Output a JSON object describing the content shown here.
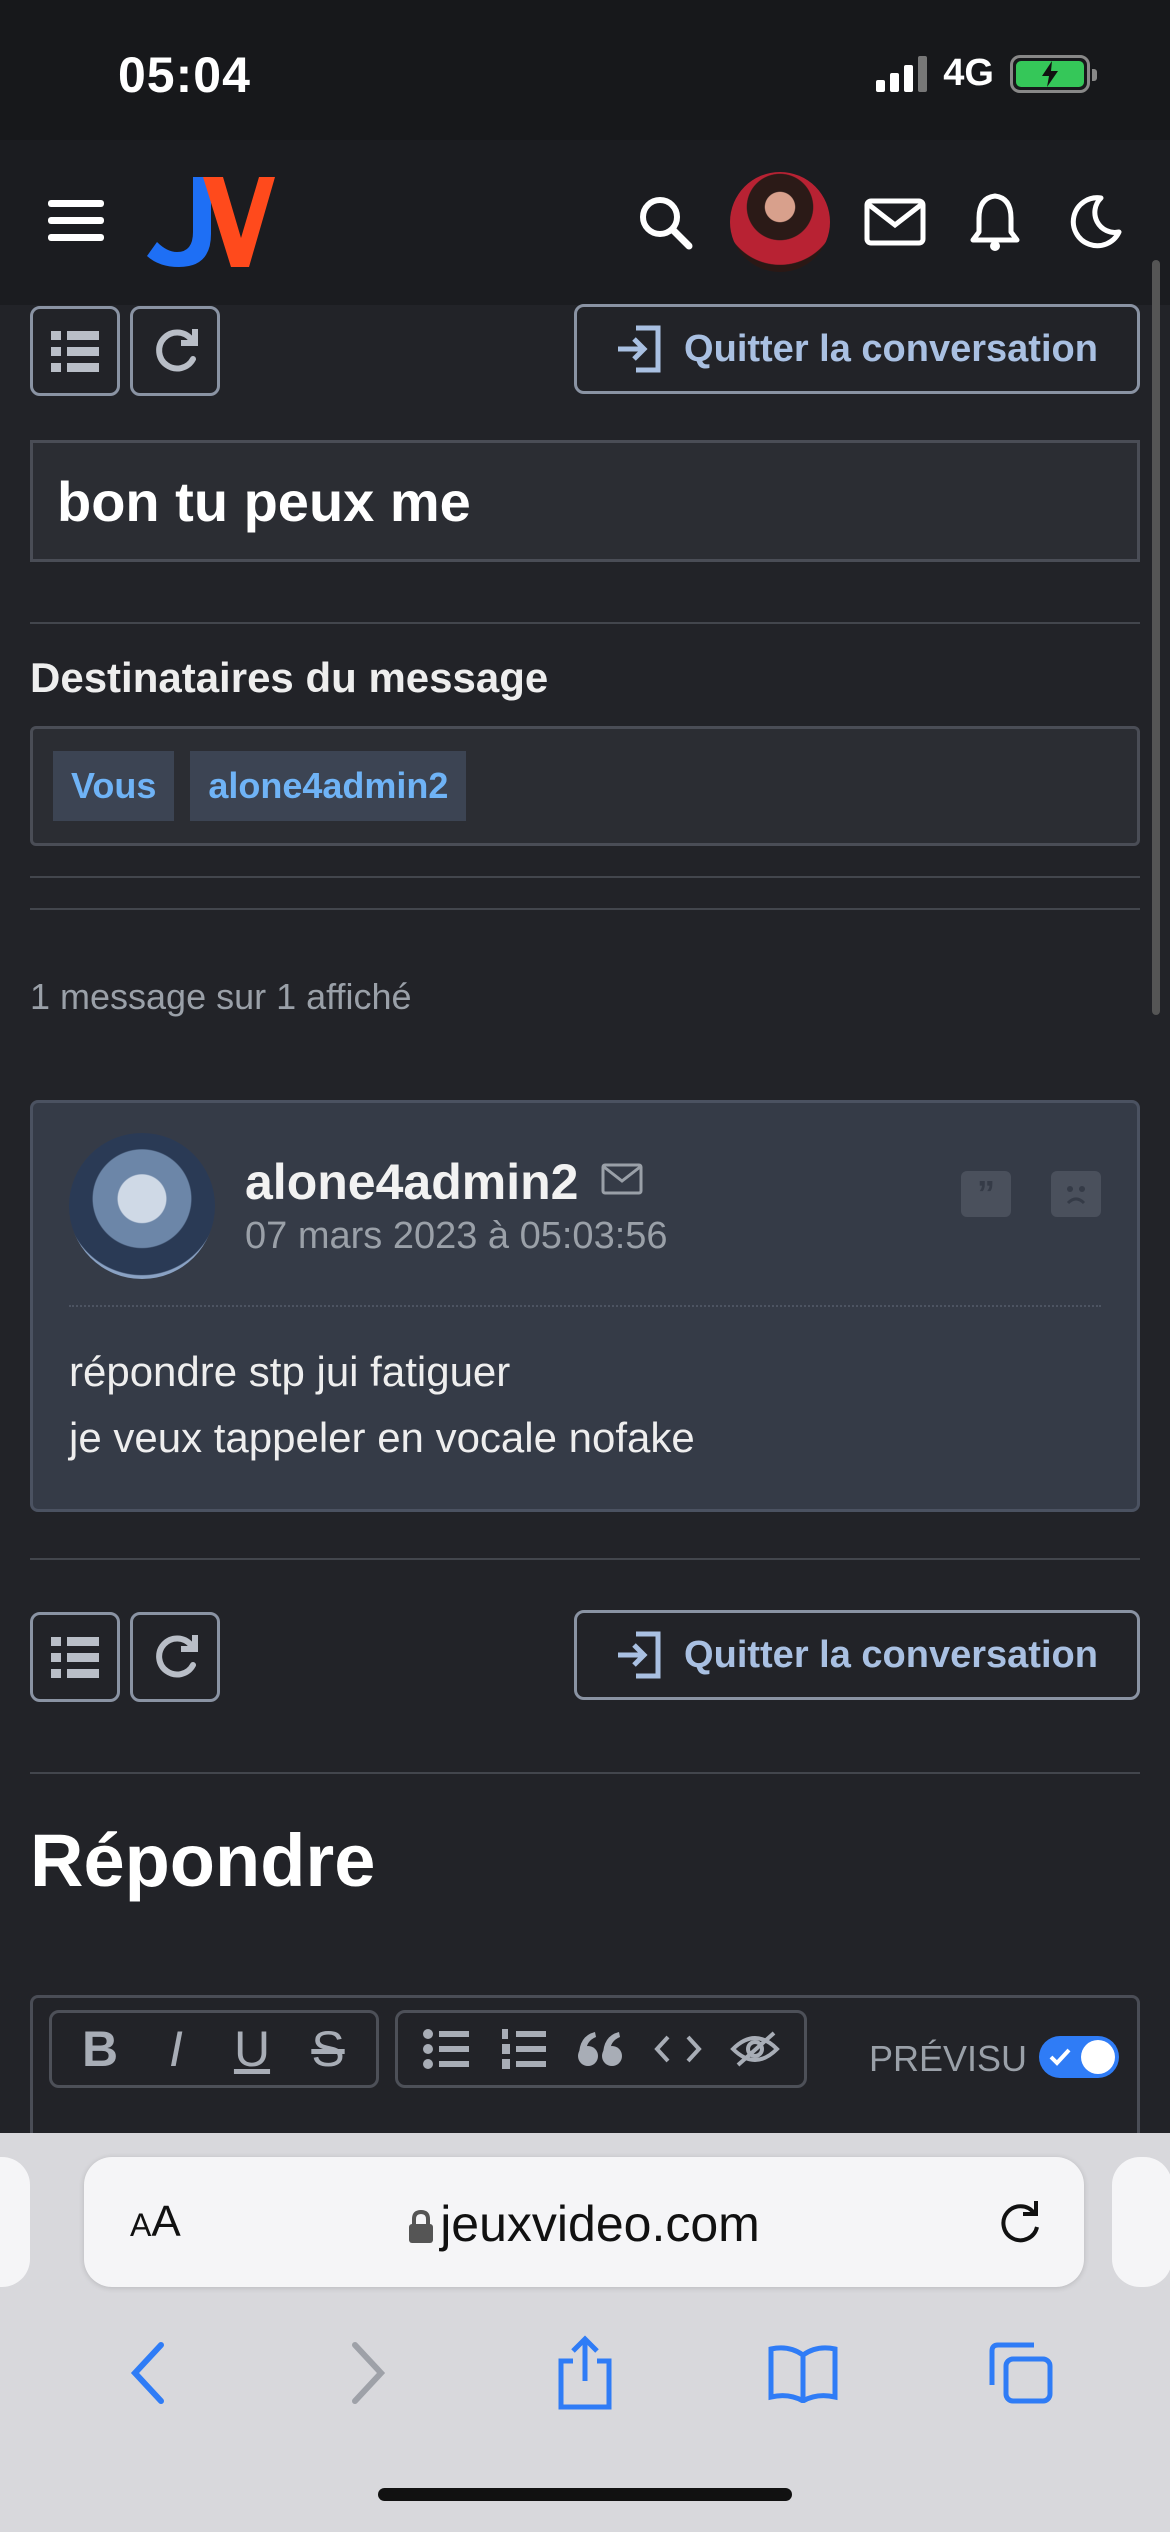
{
  "status_bar": {
    "time": "05:04",
    "network": "4G"
  },
  "nav": {
    "logo": "JV",
    "icons": [
      "menu-icon",
      "search-icon",
      "avatar",
      "mail-icon",
      "bell-icon",
      "moon-icon"
    ]
  },
  "conversation": {
    "quit_label": "Quitter la conversation",
    "title": "bon tu peux me",
    "recipients_title": "Destinataires du message",
    "recipients": [
      "Vous",
      "alone4admin2"
    ],
    "count": "1 message sur 1 affiché"
  },
  "message": {
    "author": "alone4admin2",
    "date": "07 mars 2023 à 05:03:56",
    "quote_icon": "”",
    "lines": [
      "répondre stp jui fatiguer",
      "je veux tappeler en vocale nofake"
    ]
  },
  "reply": {
    "title": "Répondre",
    "preview_label": "PRÉVISU",
    "preview_enabled": true,
    "toolbar": {
      "bold": "B",
      "italic": "I",
      "underline": "U",
      "strike": "S"
    }
  },
  "safari": {
    "aa": "AA",
    "url": "jeuxvideo.com"
  },
  "colors": {
    "accent": "#6fb3f6",
    "logo_blue": "#1e6ff5",
    "logo_red": "#ff4a1c",
    "toggle": "#2f7cf6"
  }
}
